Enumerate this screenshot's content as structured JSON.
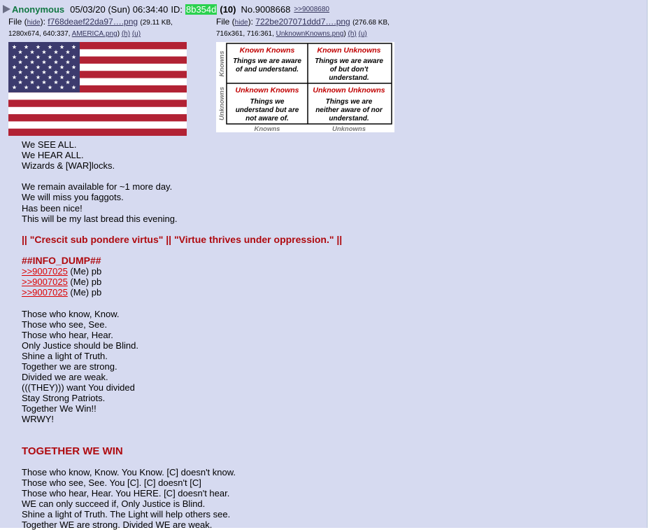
{
  "post": {
    "name": "Anonymous",
    "datetime": "05/03/20 (Sun) 06:34:40",
    "id_label": "ID:",
    "id": "8b354d",
    "post_count": "(10)",
    "number": "No.9008668",
    "backlink": ">>9008680"
  },
  "files": [
    {
      "prefix": "File (",
      "hide": "hide",
      "mid": "):",
      "filename": "f768deaef22da97….png",
      "size": "(29.11 KB,",
      "dims": "1280x674, 640:337,",
      "orig_name": "AMERICA.png",
      "close": ")",
      "h": "(h)",
      "u": "(u)"
    },
    {
      "prefix": "File (",
      "hide": "hide",
      "mid": "):",
      "filename": "722be207071ddd7….png",
      "size": "(276.68 KB,",
      "dims": "716x361, 716:361,",
      "orig_name": "UnknownKnowns.png",
      "close": ")",
      "h": "(h)",
      "u": "(u)"
    }
  ],
  "matrix": {
    "known_knowns_title": "Known Knowns",
    "known_knowns_text": [
      "Things we are aware",
      "of and understand."
    ],
    "known_unknowns_title": "Known Unknowns",
    "known_unknowns_text": [
      "Things we are aware",
      "of but don't",
      "understand."
    ],
    "unknown_knowns_title": "Unknown Knowns",
    "unknown_knowns_text": [
      "Things we",
      "understand but are",
      "not aware of."
    ],
    "unknown_unknowns_title": "Unknown Unknowns",
    "unknown_unknowns_text": [
      "Things we are",
      "neither aware of nor",
      "understand."
    ],
    "row_label_top": "Knowns",
    "row_label_bottom": "Unknowns",
    "col_label_left": "Knowns",
    "col_label_right": "Unknowns"
  },
  "message": {
    "lines": [
      {
        "t": "We SEE ALL."
      },
      {
        "t": "We HEAR ALL."
      },
      {
        "t": "Wizards & [WAR]locks."
      },
      {
        "t": ""
      },
      {
        "t": "We remain available for ~1 more day."
      },
      {
        "t": "We will miss you faggots."
      },
      {
        "t": "Has been nice!"
      },
      {
        "t": "This will be my last bread this evening."
      },
      {
        "t": ""
      },
      {
        "t": "|| \"Crescit sub pondere virtus\" || \"Virtue thrives under oppression.\" ||",
        "style": "red"
      },
      {
        "t": ""
      },
      {
        "t": "##INFO_DUMP##",
        "style": "red"
      },
      {
        "q": ">>9007025",
        "t": " (Me) pb"
      },
      {
        "q": ">>9007025",
        "t": " (Me) pb"
      },
      {
        "q": ">>9007025",
        "t": " (Me) pb"
      },
      {
        "t": ""
      },
      {
        "t": "Those who know, Know."
      },
      {
        "t": "Those who see, See."
      },
      {
        "t": "Those who hear, Hear."
      },
      {
        "t": "Only Justice should be Blind."
      },
      {
        "t": "Shine a light of Truth."
      },
      {
        "t": "Together we are strong."
      },
      {
        "t": "Divided we are weak."
      },
      {
        "t": "(((THEY))) want You divided"
      },
      {
        "t": "Stay Strong Patriots."
      },
      {
        "t": "Together We Win!!"
      },
      {
        "t": "WRWY!"
      },
      {
        "t": ""
      },
      {
        "t": ""
      },
      {
        "t": "TOGETHER WE WIN",
        "style": "big"
      },
      {
        "t": ""
      },
      {
        "t": "Those who know, Know. You Know. [C] doesn't know."
      },
      {
        "t": "Those who see, See. You [C]. [C] doesn't [C]"
      },
      {
        "t": "Those who hear, Hear. You HERE. [C] doesn't hear."
      },
      {
        "t": "WE can only succeed if, Only Justice is Blind."
      },
      {
        "t": "Shine a light of Truth. The Light will help others see."
      },
      {
        "t": "Together WE are strong. Divided WE are weak."
      }
    ]
  },
  "colors": {
    "post_bg": "#d6daf0",
    "name": "#117743",
    "id_badge": "#2bd14f",
    "link": "#34345c",
    "quote": "#dd0000",
    "red_text": "#af0a0f",
    "flag_red": "#b22234",
    "flag_blue": "#3c3b6e"
  }
}
